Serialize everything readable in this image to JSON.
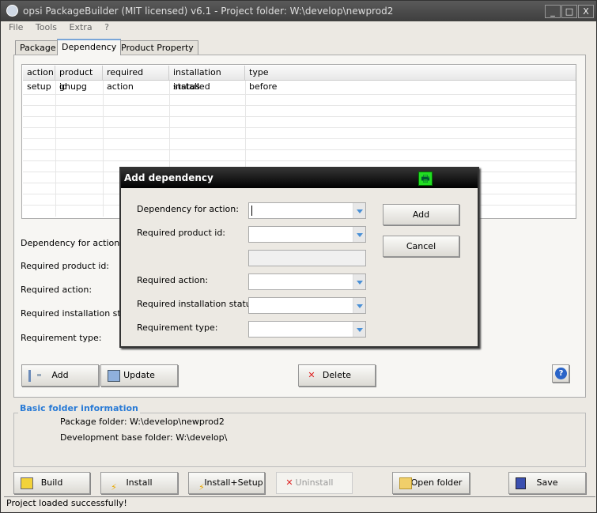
{
  "window": {
    "title": "opsi PackageBuilder (MIT licensed) v6.1 - Project folder: W:\\develop\\newprod2",
    "min": "_",
    "max": "□",
    "close": "X"
  },
  "menu": [
    "File",
    "Tools",
    "Extra",
    "?"
  ],
  "tabs": [
    {
      "label": "Package"
    },
    {
      "label": "Dependency",
      "active": true
    },
    {
      "label": "Product Property"
    }
  ],
  "grid": {
    "columns": [
      "action",
      "product id",
      "required action",
      "installation status",
      "type"
    ],
    "rows": [
      [
        "setup",
        "gnupg",
        "",
        "installed",
        "before"
      ]
    ]
  },
  "form": {
    "labels": [
      "Dependency for action:",
      "Required product id:",
      "Required action:",
      "Required installation status:",
      "Requirement type:"
    ]
  },
  "buttons": {
    "add": "Add",
    "update": "Update",
    "delete": "Delete",
    "help_icon": "help-icon"
  },
  "folder_info": {
    "title": "Basic folder information",
    "package_folder": "Package folder: W:\\develop\\newprod2",
    "base_folder": "Development base folder: W:\\develop\\"
  },
  "bottom": {
    "build": "Build",
    "install": "Install",
    "install_setup": "Install+Setup",
    "uninstall": "Uninstall",
    "open_folder": "Open folder",
    "save": "Save"
  },
  "status": "Project loaded successfully!",
  "dialog": {
    "title": "Add dependency",
    "labels": [
      "Dependency for action:",
      "Required product id:",
      "Required action:",
      "Required installation status:",
      "Requirement type:"
    ],
    "values": [
      "",
      "",
      "",
      "",
      "",
      ""
    ],
    "add": "Add",
    "cancel": "Cancel"
  },
  "colors": {
    "accent": "#2a7bd6",
    "title_bar": "#3e3e3e"
  }
}
